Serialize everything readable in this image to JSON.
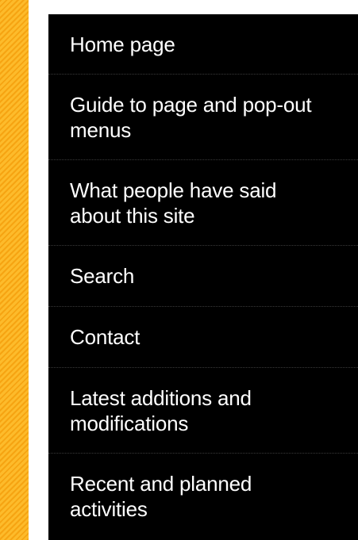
{
  "colors": {
    "stripe_primary": "#fbb21d",
    "stripe_secondary": "#f6a412",
    "menu_background": "#000000",
    "menu_text": "#ffffff",
    "divider": "#3a3a3a"
  },
  "menu": {
    "items": [
      {
        "label": "Home page"
      },
      {
        "label": "Guide to page and pop-out menus"
      },
      {
        "label": "What people have said about this site"
      },
      {
        "label": "Search"
      },
      {
        "label": "Contact"
      },
      {
        "label": "Latest additions and modifications"
      },
      {
        "label": "Recent and planned activities"
      }
    ]
  }
}
